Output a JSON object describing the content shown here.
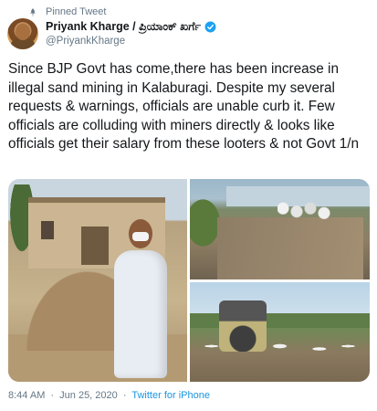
{
  "pinned": {
    "label": "Pinned Tweet",
    "icon": "pin-icon"
  },
  "author": {
    "display_name": "Priyank Kharge / ಪ್ರಿಯಾಂಕ್ ಖರ್ಗೆ",
    "handle": "@PriyankKharge",
    "verified": true,
    "verified_icon": "verified-badge-icon"
  },
  "tweet": {
    "text": "Since BJP Govt has come,there has been increase in illegal sand mining in Kalaburagi. Despite my several requests & warnings, officials are unable curb it. Few officials are colluding with miners directly & looks like officials get their salary from these looters & not Govt 1/n"
  },
  "meta": {
    "time": "8:44 AM",
    "separator": "·",
    "date": "Jun 25, 2020",
    "source": "Twitter for iPhone"
  },
  "colors": {
    "text": "#14171a",
    "secondary": "#657786",
    "link": "#1b95e0"
  }
}
